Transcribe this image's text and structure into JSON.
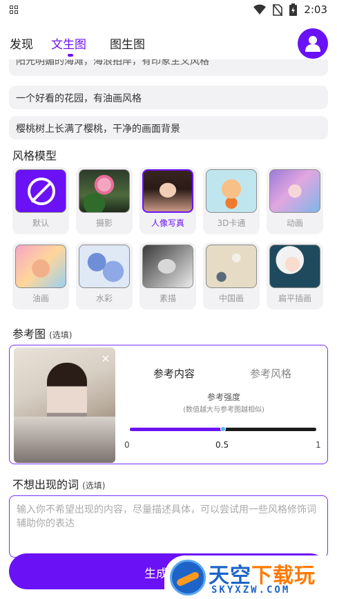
{
  "status_bar": {
    "time": "2:03",
    "icons": [
      "grid-icon",
      "wifi-icon",
      "no-sim-icon",
      "battery-icon"
    ]
  },
  "nav": {
    "tabs": [
      {
        "label": "发现",
        "active": false
      },
      {
        "label": "文生图",
        "active": true
      },
      {
        "label": "图生图",
        "active": false
      }
    ],
    "avatar_icon": "user-icon"
  },
  "prompts": [
    "阳光明媚的海滩，海浪拍岸，有印象主义风格",
    "一个好看的花园，有油画风格",
    "樱桃树上长满了樱桃，干净的画面背景"
  ],
  "style_section": {
    "title": "风格模型",
    "styles": [
      {
        "label": "默认",
        "selected": false
      },
      {
        "label": "摄影",
        "selected": false
      },
      {
        "label": "人像写真",
        "selected": true
      },
      {
        "label": "3D卡通",
        "selected": false
      },
      {
        "label": "动画",
        "selected": false
      },
      {
        "label": "油画",
        "selected": false
      },
      {
        "label": "水彩",
        "selected": false
      },
      {
        "label": "素描",
        "selected": false
      },
      {
        "label": "中国画",
        "selected": false
      },
      {
        "label": "扁平插画",
        "selected": false
      }
    ]
  },
  "reference": {
    "title": "参考图",
    "optional": "(选填)",
    "close": "×",
    "tab_content": "参考内容",
    "tab_style": "参考风格",
    "strength_label": "参考强度",
    "strength_hint": "(数值越大与参考图越相似)",
    "slider_value": 0.5,
    "tick_min": "0",
    "tick_mid": "0.5",
    "tick_max": "1"
  },
  "negative": {
    "title": "不想出现的词",
    "optional": "(选填)",
    "placeholder": "输入你不希望出现的内容，尽量描述具体，可以尝试用一些风格修饰词辅助你的表达"
  },
  "generate_button": {
    "label": "生成"
  },
  "watermark": {
    "big_a": "天",
    "big_b": "空",
    "big_c": "下载玩",
    "small": "SKYXZW.COM"
  },
  "colors": {
    "accent": "#6a12f5",
    "chip_bg": "#f2f2f4",
    "slider_knob": "#4fb3ff"
  }
}
